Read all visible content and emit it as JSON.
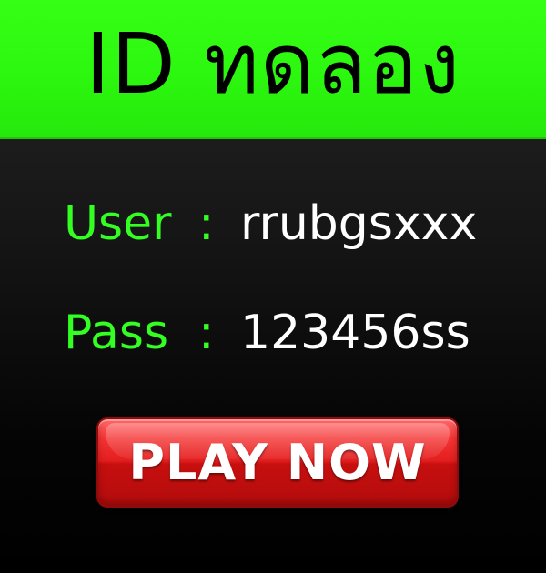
{
  "header": {
    "title": "ID  ทดลอง"
  },
  "credentials": {
    "user": {
      "label": "User",
      "separator": ":",
      "value": "rrubgsxxx"
    },
    "pass": {
      "label": "Pass",
      "separator": ":",
      "value": "123456ss"
    }
  },
  "play_button": {
    "label": "PLAY NOW"
  },
  "colors": {
    "header_green": "#2cf70f",
    "label_green": "#33ff22",
    "value_white": "#ffffff",
    "button_red": "#e31e1e",
    "background_dark": "#161616"
  }
}
